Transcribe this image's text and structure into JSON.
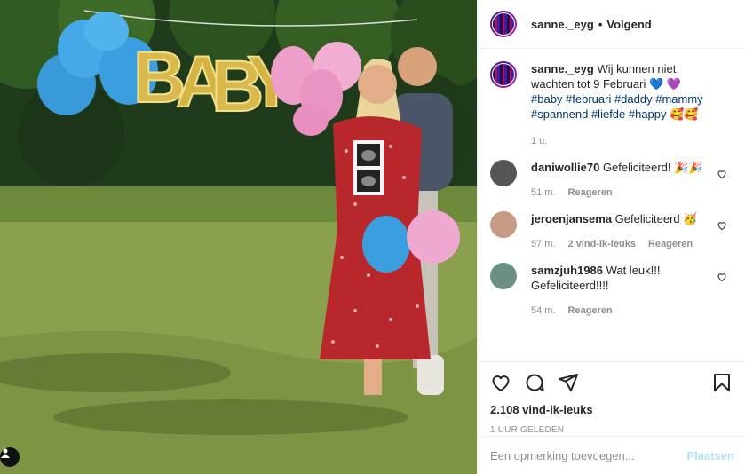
{
  "post": {
    "username": "sanne._eyg",
    "follow_separator": "•",
    "follow_label": "Volgend",
    "caption_user": "sanne._eyg",
    "caption_text": "Wij kunnen niet wachten tot 9 Februari",
    "caption_emoji": "💙 💜",
    "caption_tags": "#baby #februari #daddy #mammy #spannend #liefde #happy",
    "caption_tail_emoji": "🥰🥰",
    "caption_time": "1 u.",
    "balloon_letters": [
      "B",
      "A",
      "B",
      "Y"
    ]
  },
  "comments": [
    {
      "user": "daniwollie70",
      "text": "Gefeliciteerd! 🎉🎉",
      "time": "51 m.",
      "likes": "",
      "reply": "Reageren",
      "avatar_color": "#555"
    },
    {
      "user": "jeroenjansema",
      "text": "Gefeliciteerd 🥳",
      "time": "57 m.",
      "likes": "2 vind-ik-leuks",
      "reply": "Reageren",
      "avatar_color": "#c79a86"
    },
    {
      "user": "samzjuh1986",
      "text": "Wat leuk!!! Gefeliciteerd!!!!",
      "time": "54 m.",
      "likes": "",
      "reply": "Reageren",
      "avatar_color": "#6b8f83"
    }
  ],
  "actions": {
    "likes": "2.108 vind-ik-leuks",
    "timestamp": "1 UUR GELEDEN"
  },
  "add_comment": {
    "placeholder": "Een opmerking toevoegen...",
    "post_label": "Plaatsen"
  },
  "colors": {
    "link": "#00376b",
    "muted": "#8e8e8e",
    "post_disabled": "#b2dffc"
  }
}
